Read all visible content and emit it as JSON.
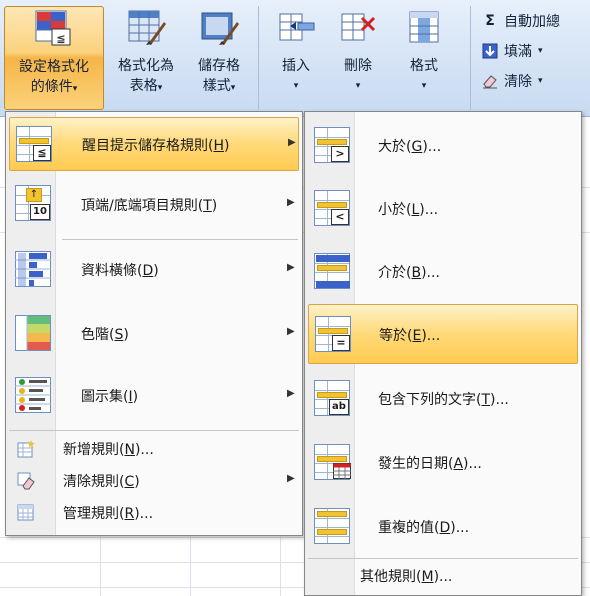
{
  "ribbon": {
    "conditional_format": {
      "line1": "設定格式化",
      "line2": "的條件"
    },
    "format_as_table": {
      "line1": "格式化為",
      "line2": "表格"
    },
    "cell_styles": {
      "line1": "儲存格",
      "line2": "樣式"
    },
    "insert": {
      "label": "插入"
    },
    "delete": {
      "label": "刪除"
    },
    "format": {
      "label": "格式"
    },
    "autosum": {
      "icon": "Σ",
      "label": "自動加總"
    },
    "fill": {
      "label": "填滿"
    },
    "clear": {
      "label": "清除"
    },
    "caret": "▾"
  },
  "main_menu": {
    "items": [
      {
        "label": "醒目提示儲存格規則",
        "accel": "H",
        "has_submenu": true,
        "icon": "highlight-rules-icon"
      },
      {
        "label": "頂端/底端項目規則",
        "accel": "T",
        "has_submenu": true,
        "icon": "top-bottom-rules-icon"
      },
      {
        "label": "資料橫條",
        "accel": "D",
        "has_submenu": true,
        "icon": "data-bars-icon"
      },
      {
        "label": "色階",
        "accel": "S",
        "has_submenu": true,
        "icon": "color-scales-icon"
      },
      {
        "label": "圖示集",
        "accel": "I",
        "has_submenu": true,
        "icon": "icon-sets-icon"
      },
      {
        "label": "新增規則",
        "accel": "N",
        "suffix": "...",
        "icon": "new-rule-icon"
      },
      {
        "label": "清除規則",
        "accel": "C",
        "has_submenu": true,
        "icon": "clear-rules-icon"
      },
      {
        "label": "管理規則",
        "accel": "R",
        "suffix": "...",
        "icon": "manage-rules-icon"
      }
    ],
    "top10_badge": "10"
  },
  "sub_menu": {
    "items": [
      {
        "label": "大於",
        "accel": "G",
        "suffix": "...",
        "badge": ">"
      },
      {
        "label": "小於",
        "accel": "L",
        "suffix": "...",
        "badge": "<"
      },
      {
        "label": "介於",
        "accel": "B",
        "suffix": "..."
      },
      {
        "label": "等於",
        "accel": "E",
        "suffix": "...",
        "badge": "="
      },
      {
        "label": "包含下列的文字",
        "accel": "T",
        "suffix": "...",
        "badge": "ab"
      },
      {
        "label": "發生的日期",
        "accel": "A",
        "suffix": "..."
      },
      {
        "label": "重複的值",
        "accel": "D",
        "suffix": "..."
      },
      {
        "label": "其他規則",
        "accel": "M",
        "suffix": "..."
      }
    ]
  },
  "colors": {
    "highlight": "#ffd979",
    "ribbon_bg": "#d5e3f5",
    "accent_yellow": "#f1c232"
  }
}
